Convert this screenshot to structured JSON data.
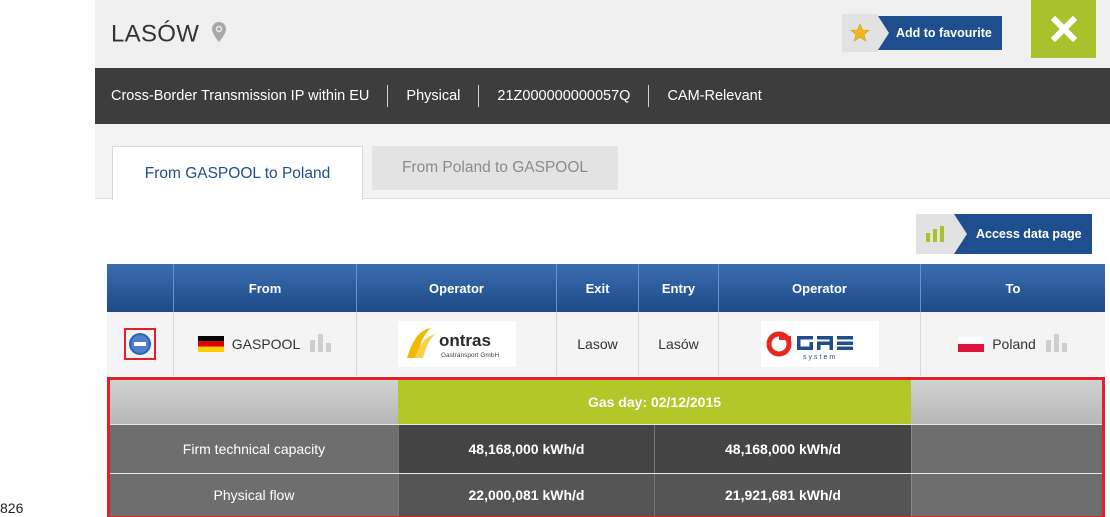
{
  "header": {
    "title": "LASÓW",
    "favourite_label": "Add to favourite"
  },
  "infobar": {
    "items": [
      "Cross-Border Transmission IP within EU",
      "Physical",
      "21Z000000000057Q",
      "CAM-Relevant"
    ]
  },
  "tabs": [
    {
      "label": "From GASPOOL to Poland",
      "active": true
    },
    {
      "label": "From Poland to GASPOOL",
      "active": false
    }
  ],
  "access_label": "Access data page",
  "flow_table": {
    "headers": [
      "",
      "From",
      "Operator",
      "Exit",
      "Entry",
      "Operator",
      "To"
    ],
    "row": {
      "from": "GASPOOL",
      "operator_from": "ontras",
      "operator_from_sub": "Gastransport GmbH",
      "exit": "Lasow",
      "entry": "Lasów",
      "operator_to": "GAZ-SYSTEM",
      "to": "Poland"
    }
  },
  "gas_table": {
    "gas_day": "Gas day: 02/12/2015",
    "rows": [
      {
        "label": "Firm technical capacity",
        "exit": "48,168,000 kWh/d",
        "entry": "48,168,000 kWh/d"
      },
      {
        "label": "Physical flow",
        "exit": "22,000,081 kWh/d",
        "entry": "21,921,681 kWh/d"
      }
    ]
  },
  "corner_text": "826",
  "colors": {
    "brand_blue": "#1f4e8f",
    "accent_green": "#a9c22b",
    "highlight_red": "#e3202a"
  }
}
